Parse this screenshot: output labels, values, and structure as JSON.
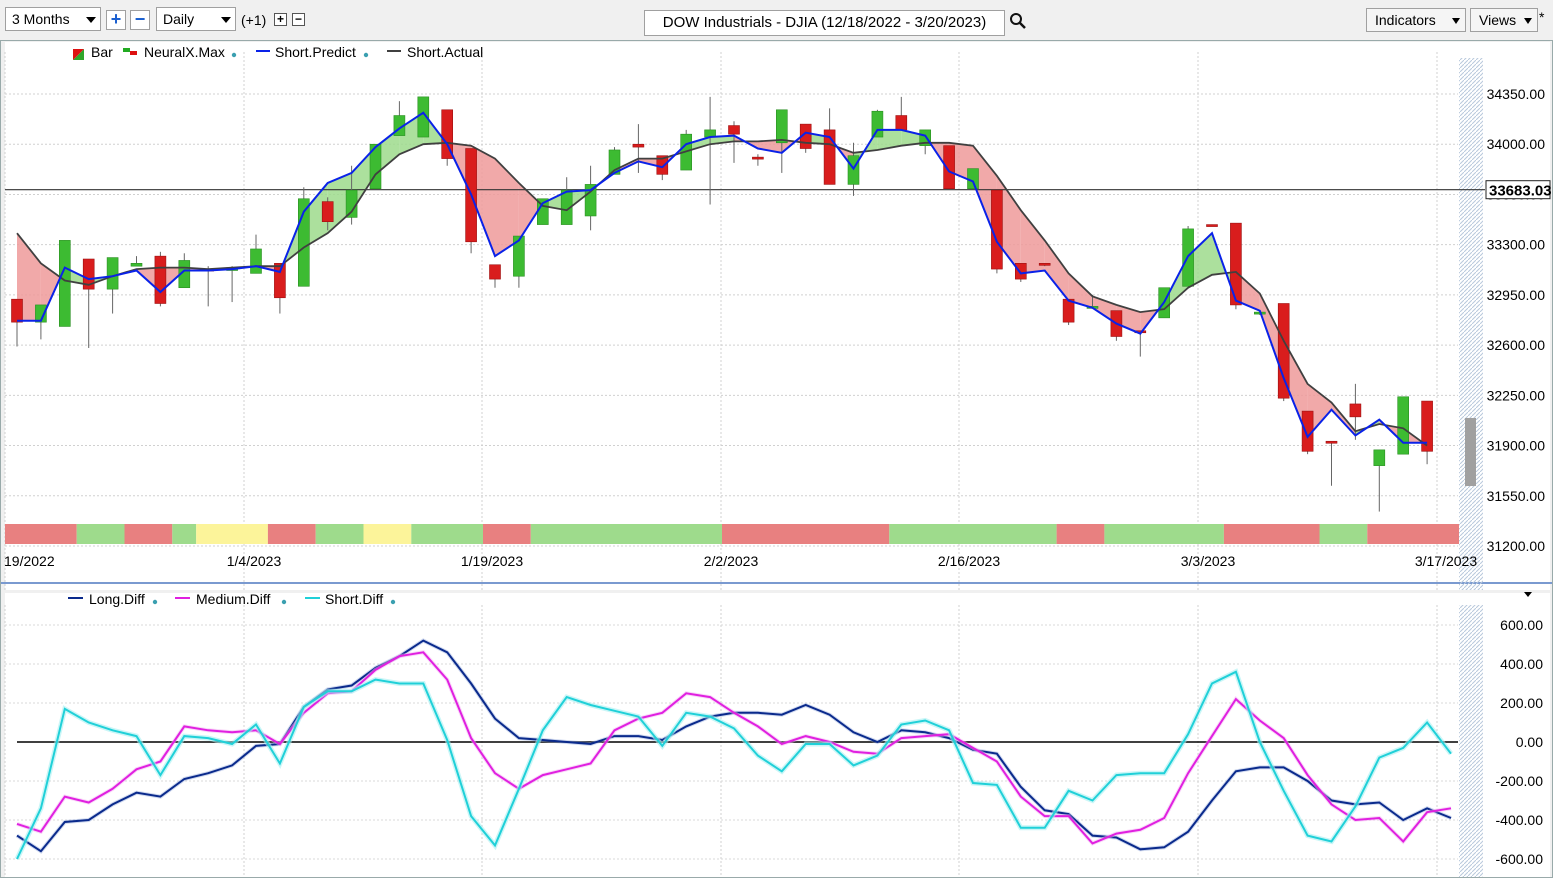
{
  "toolbar": {
    "period": "3 Months",
    "interval": "Daily",
    "offset": "(+1)",
    "title": "DOW Industrials - DJIA (12/18/2022 - 3/20/2023)",
    "indicators_label": "Indicators",
    "views_label": "Views",
    "plus_glyph": "+",
    "minus_glyph": "−",
    "star": "*"
  },
  "chart_data": [
    {
      "type": "candlestick",
      "title": "DOW Industrials - DJIA (12/18/2022 - 3/20/2023)",
      "legend": [
        "Bar",
        "NeuralX.Max",
        "Short.Predict",
        "Short.Actual"
      ],
      "ylim": [
        31200,
        34500
      ],
      "y_ticks": [
        "34350.00",
        "34000.00",
        "33650.00",
        "33300.00",
        "32950.00",
        "32600.00",
        "32250.00",
        "31900.00",
        "31550.00",
        "31200.00"
      ],
      "x_tick_labels": [
        "19/2022",
        "1/4/2023",
        "1/19/2023",
        "2/2/2023",
        "2/16/2023",
        "3/3/2023",
        "3/17/2023"
      ],
      "x_tick_index": [
        0,
        10,
        20,
        30,
        40,
        50,
        60
      ],
      "current_value_label": "33683.03",
      "current_value": 33683.03,
      "candles": [
        [
          32920,
          32920,
          32590,
          32760
        ],
        [
          32760,
          32880,
          32640,
          32880
        ],
        [
          32730,
          33330,
          32730,
          33330
        ],
        [
          33200,
          33200,
          32580,
          32990
        ],
        [
          32990,
          33210,
          32820,
          33210
        ],
        [
          33150,
          33220,
          33150,
          33170
        ],
        [
          33220,
          33250,
          32870,
          32890
        ],
        [
          33000,
          33240,
          33000,
          33190
        ],
        [
          33130,
          33150,
          32870,
          33120
        ],
        [
          33120,
          33150,
          32900,
          33140
        ],
        [
          33100,
          33370,
          33100,
          33270
        ],
        [
          33170,
          33170,
          32820,
          32930
        ],
        [
          33010,
          33700,
          33010,
          33620
        ],
        [
          33600,
          33630,
          33400,
          33460
        ],
        [
          33490,
          33850,
          33440,
          33680
        ],
        [
          33690,
          34000,
          33690,
          34000
        ],
        [
          34060,
          34300,
          34060,
          34200
        ],
        [
          34050,
          34330,
          34050,
          34330
        ],
        [
          34240,
          34240,
          33850,
          33900
        ],
        [
          33970,
          33970,
          33240,
          33320
        ],
        [
          33160,
          33160,
          33000,
          33060
        ],
        [
          33080,
          33360,
          33000,
          33360
        ],
        [
          33440,
          33620,
          33440,
          33620
        ],
        [
          33440,
          33770,
          33440,
          33680
        ],
        [
          33500,
          33850,
          33400,
          33720
        ],
        [
          33790,
          33980,
          33790,
          33960
        ],
        [
          34000,
          34140,
          33800,
          33980
        ],
        [
          33920,
          33920,
          33750,
          33790
        ],
        [
          33820,
          34100,
          33820,
          34070
        ],
        [
          34050,
          34330,
          33580,
          34100
        ],
        [
          34130,
          34160,
          33870,
          34070
        ],
        [
          33910,
          33930,
          33850,
          33900
        ],
        [
          34010,
          34240,
          33800,
          34240
        ],
        [
          34140,
          34140,
          33940,
          33970
        ],
        [
          34100,
          34250,
          33720,
          33720
        ],
        [
          33720,
          34010,
          33640,
          33920
        ],
        [
          34050,
          34240,
          34050,
          34230
        ],
        [
          34200,
          34330,
          34120,
          34100
        ],
        [
          33990,
          34100,
          33930,
          34100
        ],
        [
          33990,
          33990,
          33710,
          33690
        ],
        [
          33690,
          33830,
          33700,
          33830
        ],
        [
          33680,
          33680,
          33100,
          33130
        ],
        [
          33170,
          33170,
          33040,
          33060
        ],
        [
          33170,
          33170,
          33150,
          33160
        ],
        [
          32920,
          32920,
          32740,
          32760
        ],
        [
          32860,
          32950,
          32860,
          32870
        ],
        [
          32840,
          32840,
          32630,
          32660
        ],
        [
          32700,
          32700,
          32520,
          32690
        ],
        [
          32790,
          33000,
          32790,
          33000
        ],
        [
          33010,
          33430,
          33010,
          33410
        ],
        [
          33440,
          33440,
          33430,
          33430
        ],
        [
          33450,
          33450,
          32850,
          32880
        ],
        [
          32830,
          32830,
          32810,
          32830
        ],
        [
          32890,
          32890,
          32210,
          32230
        ],
        [
          32140,
          32140,
          31840,
          31860
        ],
        [
          31930,
          31930,
          31620,
          31920
        ],
        [
          32190,
          32330,
          31940,
          32100
        ],
        [
          31760,
          31870,
          31440,
          31870
        ],
        [
          31840,
          32240,
          31840,
          32240
        ],
        [
          32210,
          32210,
          31770,
          31860
        ]
      ],
      "series": [
        {
          "name": "Short.Predict",
          "color": "#0a22e8",
          "values": [
            32770,
            32770,
            33140,
            33060,
            33080,
            33120,
            32970,
            33120,
            33120,
            33130,
            33150,
            33110,
            33530,
            33730,
            33800,
            33980,
            34110,
            34220,
            34000,
            33650,
            33220,
            33330,
            33590,
            33670,
            33680,
            33800,
            33880,
            33840,
            34000,
            34050,
            34060,
            33970,
            33940,
            34080,
            34050,
            33830,
            34100,
            34100,
            34060,
            33810,
            33740,
            33320,
            33100,
            33120,
            32910,
            32860,
            32750,
            32680,
            32900,
            33220,
            33380,
            32910,
            32840,
            32370,
            31960,
            32150,
            31970,
            32080,
            31920,
            31920
          ]
        },
        {
          "name": "Short.Actual",
          "color": "#404040",
          "values": [
            33380,
            33170,
            33050,
            33020,
            33080,
            33130,
            33140,
            33140,
            33130,
            33140,
            33150,
            33150,
            33280,
            33380,
            33530,
            33790,
            33930,
            34000,
            34010,
            33990,
            33900,
            33730,
            33570,
            33540,
            33670,
            33820,
            33900,
            33900,
            33950,
            34000,
            34020,
            34020,
            34030,
            34010,
            34000,
            33940,
            33960,
            33990,
            34010,
            34010,
            33990,
            33780,
            33540,
            33330,
            33100,
            32940,
            32880,
            32830,
            32850,
            33000,
            33090,
            33110,
            32960,
            32630,
            32330,
            32200,
            32000,
            32050,
            32020,
            31900
          ]
        },
        {
          "name": "NeuralX.Max",
          "segments": [
            "red",
            "green",
            "red",
            "green",
            "yellow",
            "red",
            "green",
            "yellow",
            "green",
            "red",
            "green",
            "red",
            "green",
            "red",
            "green",
            "red",
            "green",
            "red",
            "green",
            "red",
            "green",
            "yellow",
            "red",
            "green",
            "red",
            "green"
          ],
          "widths": [
            2,
            1,
            1,
            0,
            2,
            1,
            1,
            1,
            2,
            1,
            7,
            6,
            6,
            1,
            4,
            3,
            1,
            3,
            3,
            5,
            1,
            1,
            2,
            3,
            5,
            2
          ]
        }
      ]
    },
    {
      "type": "line",
      "legend": [
        "Long.Diff",
        "Medium.Diff",
        "Short.Diff"
      ],
      "ylim": [
        -660,
        680
      ],
      "y_ticks": [
        "600.00",
        "400.00",
        "200.00",
        "0.00",
        "-200.00",
        "-400.00",
        "-600.00"
      ],
      "series": [
        {
          "name": "Long.Diff",
          "color": "#0a2a8c",
          "values": [
            -480,
            -560,
            -410,
            -400,
            -320,
            -260,
            -280,
            -190,
            -160,
            -120,
            -20,
            -10,
            180,
            270,
            290,
            380,
            440,
            520,
            460,
            300,
            120,
            20,
            10,
            0,
            -10,
            30,
            30,
            10,
            80,
            130,
            150,
            150,
            140,
            190,
            140,
            50,
            0,
            60,
            50,
            20,
            -40,
            -60,
            -230,
            -350,
            -370,
            -480,
            -490,
            -550,
            -540,
            -460,
            -300,
            -150,
            -130,
            -130,
            -200,
            -300,
            -320,
            -310,
            -400,
            -340,
            -390
          ]
        },
        {
          "name": "Medium.Diff",
          "color": "#e020e0",
          "values": [
            -420,
            -460,
            -280,
            -310,
            -240,
            -140,
            -100,
            80,
            60,
            50,
            60,
            -10,
            150,
            250,
            260,
            370,
            440,
            460,
            320,
            20,
            -160,
            -240,
            -170,
            -140,
            -110,
            60,
            120,
            150,
            250,
            230,
            150,
            80,
            -10,
            30,
            0,
            -50,
            -60,
            20,
            30,
            40,
            -30,
            -100,
            -280,
            -380,
            -380,
            -520,
            -470,
            -450,
            -390,
            -160,
            30,
            220,
            110,
            20,
            -170,
            -320,
            -400,
            -390,
            -510,
            -360,
            -340
          ]
        },
        {
          "name": "Short.Diff",
          "color": "#20d0d8",
          "values": [
            -600,
            -340,
            170,
            100,
            60,
            30,
            -170,
            30,
            20,
            -10,
            90,
            -110,
            180,
            260,
            260,
            320,
            300,
            300,
            10,
            -380,
            -530,
            -240,
            60,
            230,
            190,
            160,
            130,
            -20,
            150,
            130,
            70,
            -70,
            -150,
            -10,
            -10,
            -120,
            -70,
            90,
            110,
            60,
            -210,
            -220,
            -440,
            -440,
            -250,
            -300,
            -170,
            -160,
            -160,
            40,
            300,
            360,
            0,
            -250,
            -480,
            -510,
            -330,
            -80,
            -30,
            100,
            -60
          ]
        }
      ]
    }
  ]
}
